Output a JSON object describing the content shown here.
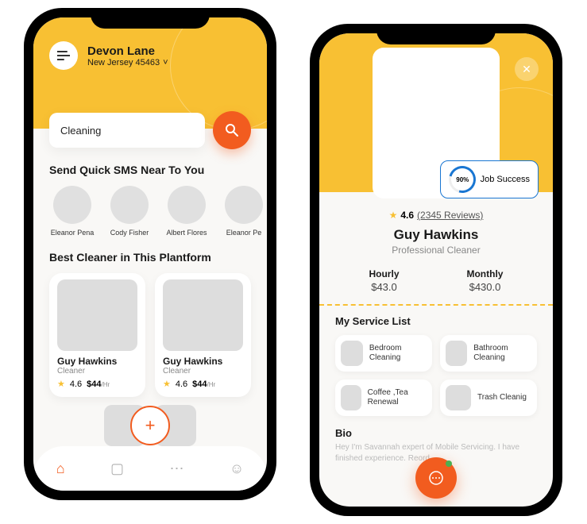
{
  "left": {
    "user_name": "Devon Lane",
    "user_location": "New Jersey 45463",
    "search_placeholder": "Cleaning",
    "sms_title": "Send Quick SMS Near To You",
    "avatars": [
      {
        "name": "Eleanor Pena"
      },
      {
        "name": "Cody Fisher"
      },
      {
        "name": "Albert Flores"
      },
      {
        "name": "Eleanor Pe"
      }
    ],
    "best_title": "Best Cleaner in This Plantform",
    "cleaners": [
      {
        "name": "Guy Hawkins",
        "role": "Cleaner",
        "rating": "4.6",
        "rate": "$44",
        "rate_unit": "/Hr"
      },
      {
        "name": "Guy Hawkins",
        "role": "Cleaner",
        "rating": "4.6",
        "rate": "$44",
        "rate_unit": "/Hr"
      }
    ]
  },
  "right": {
    "job_success_pct": "90%",
    "job_success_label": "Job Success",
    "rating": "4.6",
    "reviews": "(2345 Reviews)",
    "name": "Guy Hawkins",
    "role": "Professional Cleaner",
    "hourly_label": "Hourly",
    "hourly_price": "$43.0",
    "monthly_label": "Monthly",
    "monthly_price": "$430.0",
    "services_title": "My Service List",
    "services": [
      {
        "name": "Bedroom Cleaning"
      },
      {
        "name": "Bathroom Cleaning"
      },
      {
        "name": "Coffee ,Tea Renewal"
      },
      {
        "name": "Trash Cleanig"
      }
    ],
    "bio_title": "Bio",
    "bio_text": "Hey I'm Savannah expert of Mobile Servicing. I have finished experience. Reord"
  }
}
